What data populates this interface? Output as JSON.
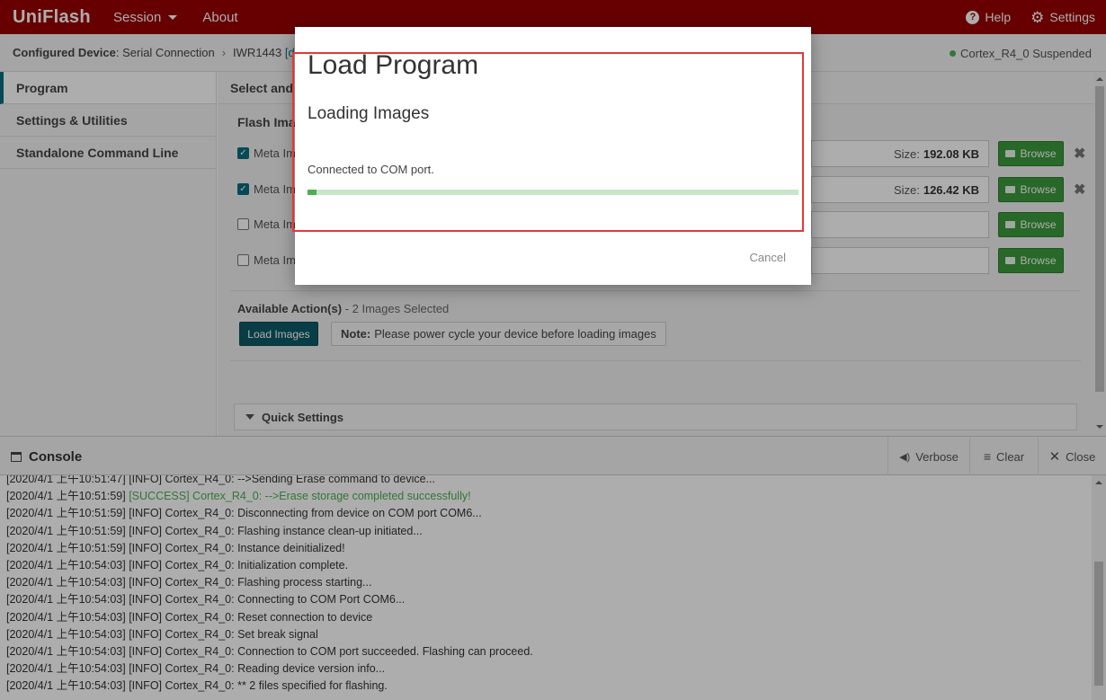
{
  "header": {
    "brand": "UniFlash",
    "menu": [
      {
        "label": "Session"
      },
      {
        "label": "About"
      }
    ],
    "help_label": "Help",
    "settings_label": "Settings"
  },
  "breadcrumb": {
    "prefix": "Configured Device",
    "connection": " : Serial Connection",
    "device": "IWR1443",
    "link": "[dov",
    "status": "Cortex_R4_0 Suspended"
  },
  "sidebar": {
    "items": [
      {
        "label": "Program"
      },
      {
        "label": "Settings & Utilities"
      },
      {
        "label": "Standalone Command Line"
      }
    ]
  },
  "main": {
    "header": "Select and I",
    "flash_title": "Flash Imag",
    "images": [
      {
        "label": "Meta Im",
        "checked": true,
        "size_label": "Size:",
        "size": "192.08 KB"
      },
      {
        "label": "Meta Im",
        "checked": true,
        "size_label": "Size:",
        "size": "126.42 KB"
      },
      {
        "label": "Meta Im",
        "checked": false,
        "size_label": "",
        "size": ""
      },
      {
        "label": "Meta Im",
        "checked": false,
        "size_label": "",
        "size": ""
      }
    ],
    "browse_label": "Browse",
    "actions_title": "Available Action(s)",
    "actions_count": " - 2 Images Selected",
    "load_button": "Load Images",
    "note_bold": "Note:",
    "note_text": "Please power cycle your device before loading images",
    "quick_settings": "Quick Settings"
  },
  "modal": {
    "title": "Load Program",
    "subtitle": "Loading Images",
    "message": "Connected to COM port.",
    "progress": 0.018,
    "cancel_label": "Cancel"
  },
  "console": {
    "title": "Console",
    "verbose_label": "Verbose",
    "clear_label": "Clear",
    "close_label": "Close",
    "lines": [
      {
        "time": "[2020/4/1 上午10:51:47]",
        "text": " [INFO] Cortex_R4_0: -->Sending Erase command to device...",
        "success": false
      },
      {
        "time": "[2020/4/1 上午10:51:59]",
        "text": " [SUCCESS] Cortex_R4_0: -->Erase storage completed successfully!",
        "success": true
      },
      {
        "time": "[2020/4/1 上午10:51:59]",
        "text": " [INFO] Cortex_R4_0: Disconnecting from device on COM port COM6...",
        "success": false
      },
      {
        "time": "[2020/4/1 上午10:51:59]",
        "text": " [INFO] Cortex_R4_0: Flashing instance clean-up initiated...",
        "success": false
      },
      {
        "time": "[2020/4/1 上午10:51:59]",
        "text": " [INFO] Cortex_R4_0: Instance deinitialized!",
        "success": false
      },
      {
        "time": "[2020/4/1 上午10:54:03]",
        "text": " [INFO] Cortex_R4_0: Initialization complete.",
        "success": false
      },
      {
        "time": "[2020/4/1 上午10:54:03]",
        "text": " [INFO] Cortex_R4_0: Flashing process starting...",
        "success": false
      },
      {
        "time": "[2020/4/1 上午10:54:03]",
        "text": " [INFO] Cortex_R4_0: Connecting to COM Port COM6...",
        "success": false
      },
      {
        "time": "[2020/4/1 上午10:54:03]",
        "text": " [INFO] Cortex_R4_0: Reset connection to device",
        "success": false
      },
      {
        "time": "[2020/4/1 上午10:54:03]",
        "text": " [INFO] Cortex_R4_0: Set break signal",
        "success": false
      },
      {
        "time": "[2020/4/1 上午10:54:03]",
        "text": " [INFO] Cortex_R4_0: Connection to COM port succeeded. Flashing can proceed.",
        "success": false
      },
      {
        "time": "[2020/4/1 上午10:54:03]",
        "text": " [INFO] Cortex_R4_0: Reading device version info...",
        "success": false
      },
      {
        "time": "[2020/4/1 上午10:54:03]",
        "text": " [INFO] Cortex_R4_0: ** 2 files specified for flashing.",
        "success": false
      }
    ]
  },
  "colors": {
    "brand": "#990000",
    "accent": "#0a6c7f",
    "browse": "#3c9a3c",
    "success": "#4caf50",
    "highlight": "#e53935"
  }
}
